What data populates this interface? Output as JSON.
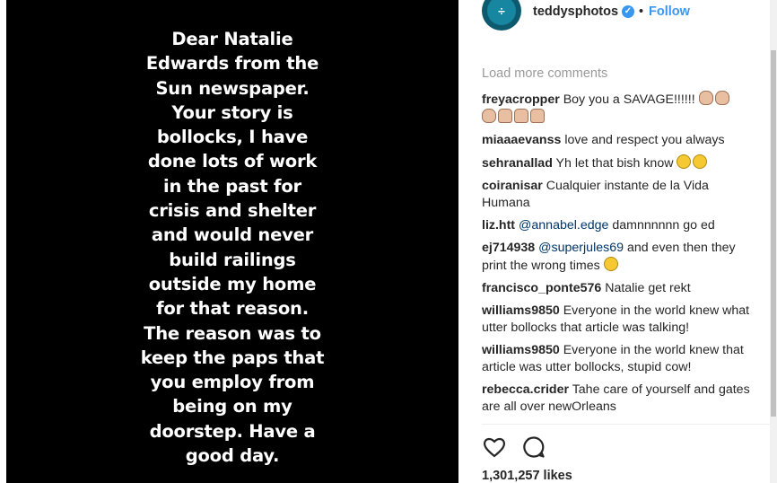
{
  "post": {
    "story_lines": [
      "Dear Natalie",
      "Edwards from the",
      "Sun newspaper.",
      "Your story is",
      "bollocks, I have",
      "done lots of work",
      "in the past for",
      "crisis and shelter",
      "and would never",
      "build railings",
      "outside my home",
      "for that reason.",
      "The reason was to",
      "keep the paps that",
      "you employ from",
      "being on my",
      "doorstep. Have a",
      "good day."
    ]
  },
  "header": {
    "username": "teddysphotos",
    "avatar_glyph": "÷",
    "verified_glyph": "✓",
    "separator": "•",
    "follow_label": "Follow"
  },
  "comments": {
    "load_more": "Load more comments",
    "items": [
      {
        "user": "freyacropper",
        "text": "Boy you a SAVAGE!!!!!! "
      },
      {
        "user": "miaaaevanss",
        "text": "love and respect you always"
      },
      {
        "user": "sehranallad",
        "text": "Yh let that bish know "
      },
      {
        "user": "coiranisar",
        "text": "Cualquier instante de la Vida Humana"
      },
      {
        "user": "liz.htt",
        "mention": "@annabel.edge",
        "text": " damnnnnnn go ed"
      },
      {
        "user": "ej714938",
        "mention": "@superjules69",
        "text": " and even then they print the wrong times "
      },
      {
        "user": "francisco_ponte576",
        "text": "Natalie get rekt"
      },
      {
        "user": "williams9850",
        "text": "Everyone in the world knew what utter bollocks that article was talking!"
      },
      {
        "user": "williams9850",
        "text": "Everyone in the world knew that article was utter bollocks, stupid cow!"
      },
      {
        "user": "rebecca.crider",
        "text": "Tahe care of yourself and gates are all over newOrleans"
      }
    ]
  },
  "actions": {
    "like_icon": "heart-outline",
    "comment_icon": "speech-bubble-outline"
  },
  "likes": {
    "count_text": "1,301,257 likes"
  },
  "colors": {
    "link": "#3897f0",
    "text": "#262626",
    "muted": "#999999",
    "photo_bg": "#000000"
  }
}
